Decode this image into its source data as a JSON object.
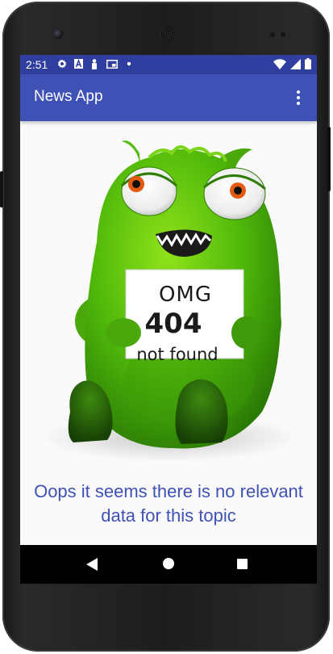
{
  "status_bar": {
    "time": "2:51",
    "notification_icons": [
      "settings-icon",
      "font-a-icon",
      "accessibility-person-icon",
      "picture-in-picture-icon",
      "dot-icon"
    ],
    "system_icons": [
      "wifi-icon",
      "cell-signal-icon",
      "battery-icon"
    ],
    "color": "#303f9f"
  },
  "app_bar": {
    "title": "News App",
    "overflow_icon": "more-vert-icon",
    "color": "#3f51b5"
  },
  "illustration": {
    "name": "green-monster-404",
    "sign": {
      "line1": "OMG",
      "line2": "404",
      "line3": "not found"
    }
  },
  "message": "Oops it seems there is no relevant data for this topic",
  "nav_bar": {
    "back_icon": "back-triangle-icon",
    "home_icon": "home-circle-icon",
    "recents_icon": "recents-square-icon"
  },
  "accent_color": "#3f51b5"
}
